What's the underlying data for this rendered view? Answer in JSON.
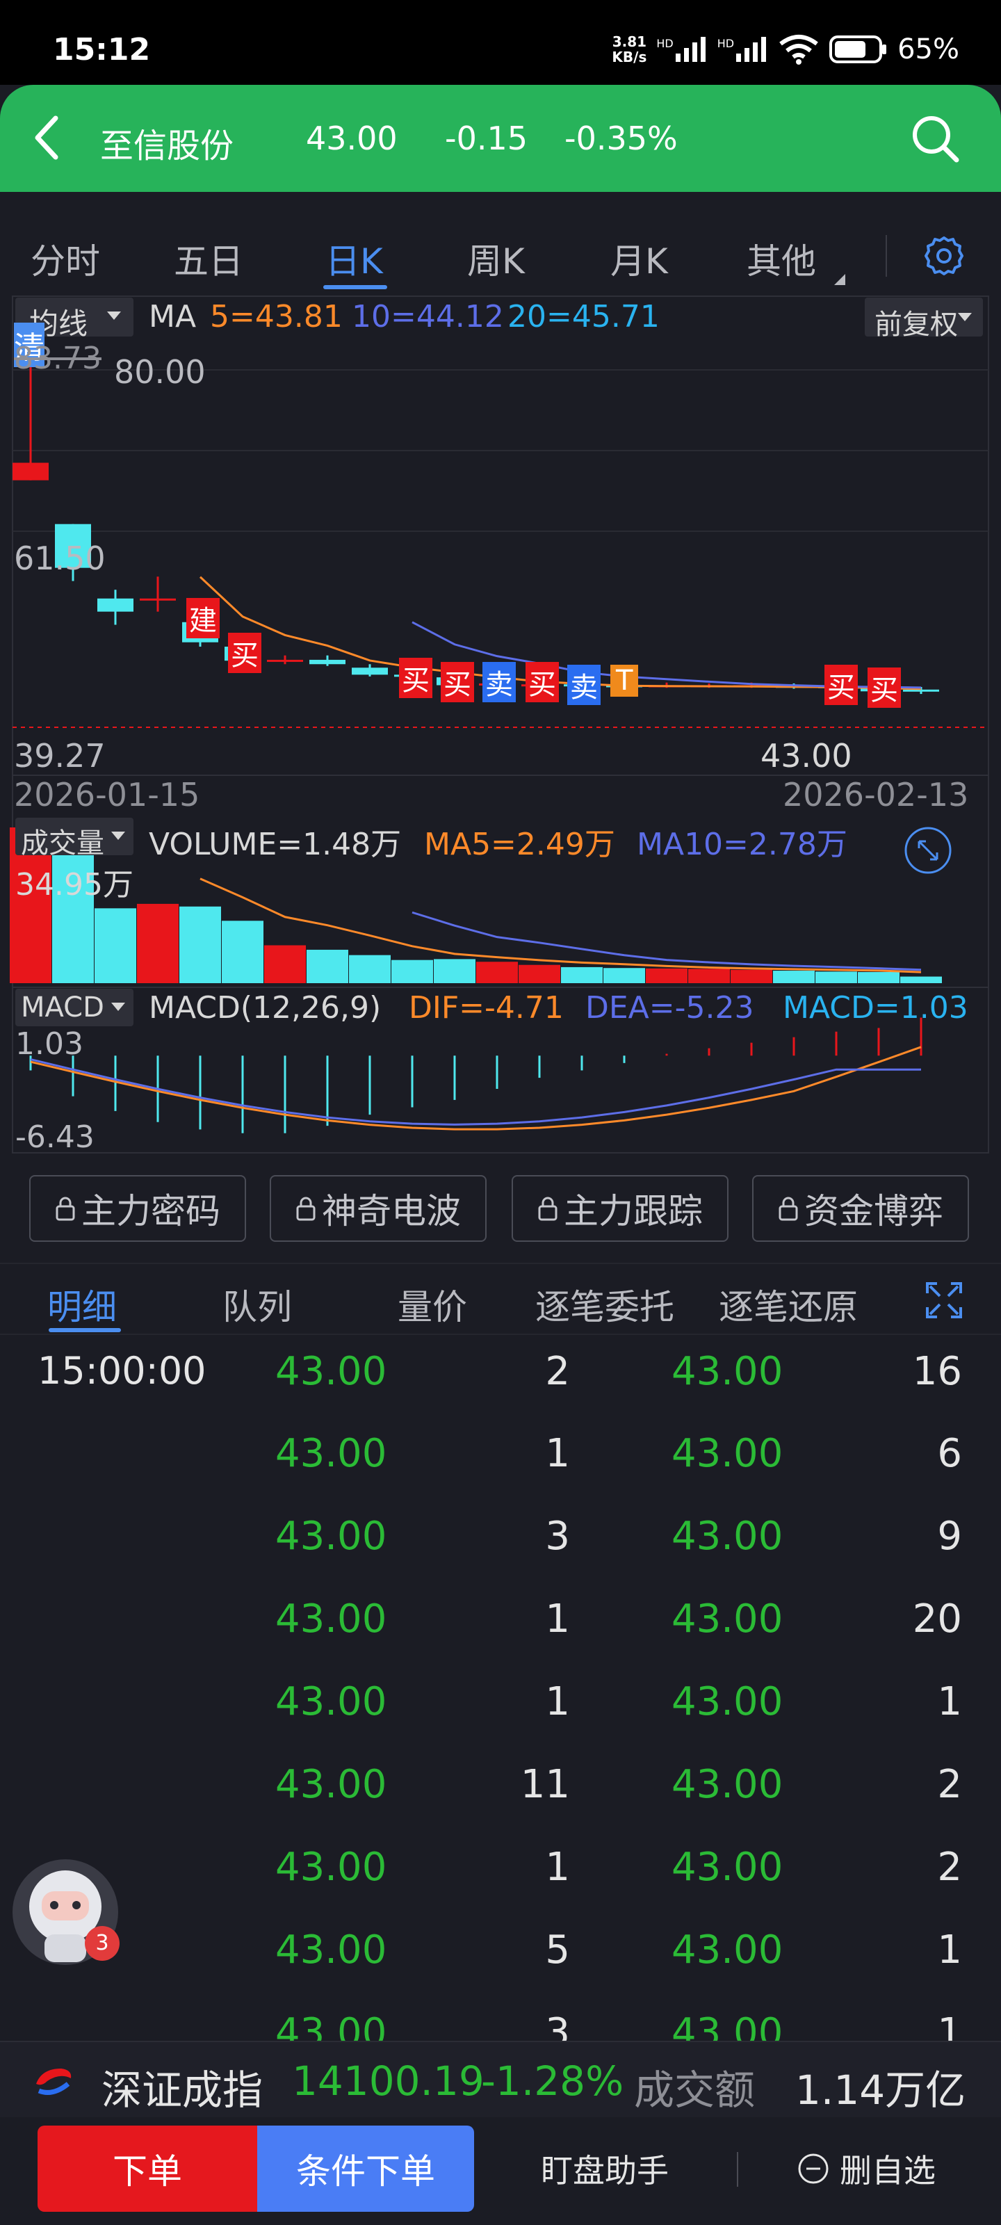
{
  "status": {
    "time": "15:12",
    "net_speed": "3.81",
    "net_unit": "KB/s",
    "net1": "HD",
    "net2": "HD",
    "battery": "65%"
  },
  "header": {
    "title": "至信股份",
    "price": "43.00",
    "change": "-0.15",
    "change_pct": "-0.35%"
  },
  "period_tabs": [
    "分时",
    "五日",
    "日K",
    "周K",
    "月K",
    "其他"
  ],
  "active_period": "日K",
  "chart": {
    "indicator_select": "均线",
    "ma_label": "MA",
    "ma5": "5=43.81",
    "ma10": "10=44.12",
    "ma20": "20=45.71",
    "adjust_select": "前复权",
    "clear_tag": "清",
    "high_label": "83.73",
    "y_top": "80.00",
    "y_mid": "61.50",
    "y_low": "39.27",
    "last_price": "43.00",
    "date_start": "2026-01-15",
    "date_end": "2026-02-13",
    "trade_markers": [
      "建",
      "买",
      "买",
      "买",
      "卖",
      "买",
      "卖",
      "T",
      "买",
      "买"
    ],
    "volume_select": "成交量",
    "volume": "VOLUME=1.48万",
    "vol_ma5": "MA5=2.49万",
    "vol_ma10": "MA10=2.78万",
    "vol_max": "34.95万",
    "macd_select": "MACD",
    "macd_params": "MACD(12,26,9)",
    "dif": "DIF=-4.71",
    "dea": "DEA=-5.23",
    "macd_val": "MACD=1.03",
    "macd_top": "1.03",
    "macd_bottom": "-6.43",
    "colors": {
      "up": "#e8161b",
      "down": "#4fe8ee",
      "ma5": "#ff8a2a",
      "ma10": "#5d6ee8",
      "ma20": "#2ab3f0"
    }
  },
  "chart_data": {
    "type": "candlestick",
    "x_start": "2026-01-15",
    "x_end": "2026-02-13",
    "y_range": [
      39.27,
      83.73
    ],
    "candles": [
      {
        "o": 67,
        "c": 69,
        "h": 83.73,
        "l": 67,
        "up": true
      },
      {
        "o": 62,
        "c": 57,
        "h": 62,
        "l": 55.5,
        "up": false
      },
      {
        "o": 53.5,
        "c": 52,
        "h": 54.5,
        "l": 50.5,
        "up": false
      },
      {
        "o": 53.5,
        "c": 53.3,
        "h": 56,
        "l": 52,
        "up": true
      },
      {
        "o": 50.8,
        "c": 48.5,
        "h": 52,
        "l": 48,
        "up": false
      },
      {
        "o": 48,
        "c": 46.4,
        "h": 48.5,
        "l": 46,
        "up": false
      },
      {
        "o": 46.5,
        "c": 46.4,
        "h": 47,
        "l": 46,
        "up": true
      },
      {
        "o": 46.5,
        "c": 46,
        "h": 47,
        "l": 45.8,
        "up": false
      },
      {
        "o": 45.6,
        "c": 44.8,
        "h": 46,
        "l": 44.6,
        "up": false
      },
      {
        "o": 44.8,
        "c": 44.6,
        "h": 45.5,
        "l": 44.3,
        "up": false
      },
      {
        "o": 44.5,
        "c": 43.6,
        "h": 44.8,
        "l": 43.5,
        "up": false
      },
      {
        "o": 43.8,
        "c": 43.6,
        "h": 44.2,
        "l": 43.3,
        "up": true
      },
      {
        "o": 43.7,
        "c": 43.5,
        "h": 44.0,
        "l": 43.2,
        "up": true
      },
      {
        "o": 43.7,
        "c": 43.5,
        "h": 44.0,
        "l": 43.3,
        "up": false
      },
      {
        "o": 43.6,
        "c": 43.5,
        "h": 43.9,
        "l": 43.2,
        "up": false
      },
      {
        "o": 43.6,
        "c": 43.4,
        "h": 43.9,
        "l": 43.3,
        "up": true
      },
      {
        "o": 43.6,
        "c": 43.5,
        "h": 43.8,
        "l": 43.3,
        "up": true
      },
      {
        "o": 43.6,
        "c": 43.4,
        "h": 43.9,
        "l": 43.3,
        "up": true
      },
      {
        "o": 43.6,
        "c": 43.3,
        "h": 43.8,
        "l": 43.2,
        "up": false
      },
      {
        "o": 43.5,
        "c": 43.3,
        "h": 43.7,
        "l": 43.1,
        "up": false
      },
      {
        "o": 43.4,
        "c": 42.9,
        "h": 43.6,
        "l": 42.8,
        "up": false
      },
      {
        "o": 43.1,
        "c": 43.0,
        "h": 43.4,
        "l": 42.6,
        "up": false
      }
    ],
    "volume_wan": [
      34.95,
      30.5,
      16.8,
      17.8,
      17.2,
      14.0,
      8.5,
      7.5,
      6.3,
      5.2,
      5.4,
      4.8,
      4.1,
      3.6,
      3.4,
      3.3,
      3.2,
      3.0,
      2.8,
      2.6,
      2.5,
      1.48
    ],
    "macd_hist": [
      -0.4,
      -1.1,
      -1.5,
      -1.8,
      -2.0,
      -2.1,
      -2.1,
      -1.9,
      -1.6,
      -1.4,
      -1.2,
      -0.9,
      -0.6,
      -0.4,
      -0.2,
      0.05,
      0.2,
      0.35,
      0.5,
      0.65,
      0.75,
      1.03
    ]
  },
  "features": [
    "主力密码",
    "神奇电波",
    "主力跟踪",
    "资金博弈"
  ],
  "trade_tabs": [
    "明细",
    "队列",
    "量价",
    "逐笔委托",
    "逐笔还原"
  ],
  "active_trade_tab": "明细",
  "trades": [
    {
      "time": "15:00:00",
      "p1": "43.00",
      "v1": "2",
      "p2": "43.00",
      "v2": "16"
    },
    {
      "time": "",
      "p1": "43.00",
      "v1": "1",
      "p2": "43.00",
      "v2": "6"
    },
    {
      "time": "",
      "p1": "43.00",
      "v1": "3",
      "p2": "43.00",
      "v2": "9"
    },
    {
      "time": "",
      "p1": "43.00",
      "v1": "1",
      "p2": "43.00",
      "v2": "20"
    },
    {
      "time": "",
      "p1": "43.00",
      "v1": "1",
      "p2": "43.00",
      "v2": "1"
    },
    {
      "time": "",
      "p1": "43.00",
      "v1": "11",
      "p2": "43.00",
      "v2": "2"
    },
    {
      "time": "",
      "p1": "43.00",
      "v1": "1",
      "p2": "43.00",
      "v2": "2"
    },
    {
      "time": "",
      "p1": "43.00",
      "v1": "5",
      "p2": "43.00",
      "v2": "1"
    },
    {
      "time": "",
      "p1": "43.00",
      "v1": "3",
      "p2": "43.00",
      "v2": "1"
    }
  ],
  "assistant_badge": "3",
  "index": {
    "name": "深证成指",
    "value": "14100.19",
    "pct": "-1.28%",
    "turnover_label": "成交额",
    "turnover": "1.14万亿"
  },
  "bottom": {
    "order": "下单",
    "cond_order": "条件下单",
    "watch_helper": "盯盘助手",
    "remove_watch": "删自选"
  }
}
